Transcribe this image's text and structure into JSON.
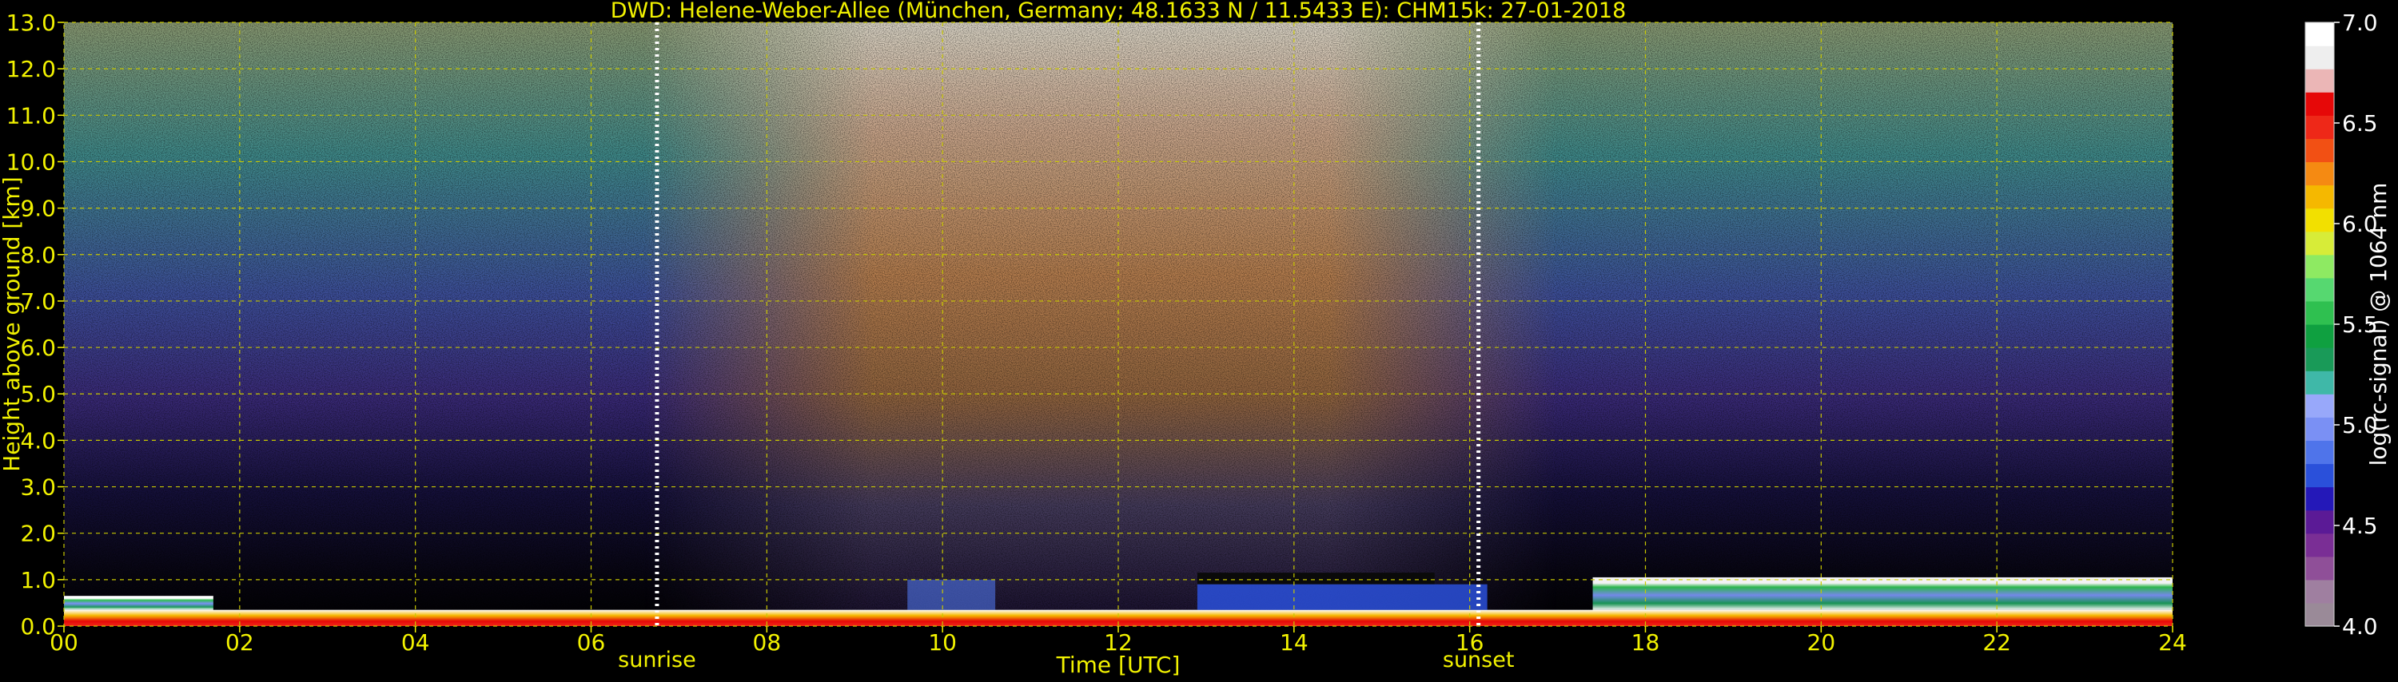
{
  "chart_data": {
    "type": "heatmap",
    "title": "DWD: Helene-Weber-Allee (München, Germany; 48.1633 N / 11.5433 E):    CHM15k: 27-01-2018",
    "xlabel": "Time [UTC]",
    "ylabel": "Height above ground [km]",
    "xlim": [
      0,
      24
    ],
    "ylim": [
      0,
      13
    ],
    "x_ticks": [
      "00",
      "02",
      "04",
      "06",
      "08",
      "10",
      "12",
      "14",
      "16",
      "18",
      "20",
      "22",
      "24"
    ],
    "y_ticks": [
      "0.0",
      "1.0",
      "2.0",
      "3.0",
      "4.0",
      "5.0",
      "6.0",
      "7.0",
      "8.0",
      "9.0",
      "10.0",
      "11.0",
      "12.0",
      "13.0"
    ],
    "grid": true,
    "markers": [
      {
        "label": "sunrise",
        "x": 6.75
      },
      {
        "label": "sunset",
        "x": 16.1
      }
    ],
    "colorbar": {
      "label": "log(rc-signal) @ 1064 nm",
      "range": [
        4.0,
        7.0
      ],
      "ticks": [
        "4.0",
        "4.5",
        "5.0",
        "5.5",
        "6.0",
        "6.5",
        "7.0"
      ],
      "colors": [
        "#9a8a98",
        "#9f7fa0",
        "#8f4f98",
        "#7a2e95",
        "#5b1a96",
        "#2418b8",
        "#2a50da",
        "#4f74ea",
        "#7a90f4",
        "#98a8fa",
        "#3fb8a8",
        "#199a58",
        "#0fa040",
        "#2fc050",
        "#56d870",
        "#8eea62",
        "#d7ec38",
        "#f2e000",
        "#f5b800",
        "#f58a12",
        "#f25014",
        "#ee2818",
        "#e60808",
        "#ebb6b6",
        "#eeeeee",
        "#ffffff"
      ]
    },
    "colors": {
      "text": "#f2f200",
      "grid": "#c8c800",
      "background": "#000000"
    }
  }
}
